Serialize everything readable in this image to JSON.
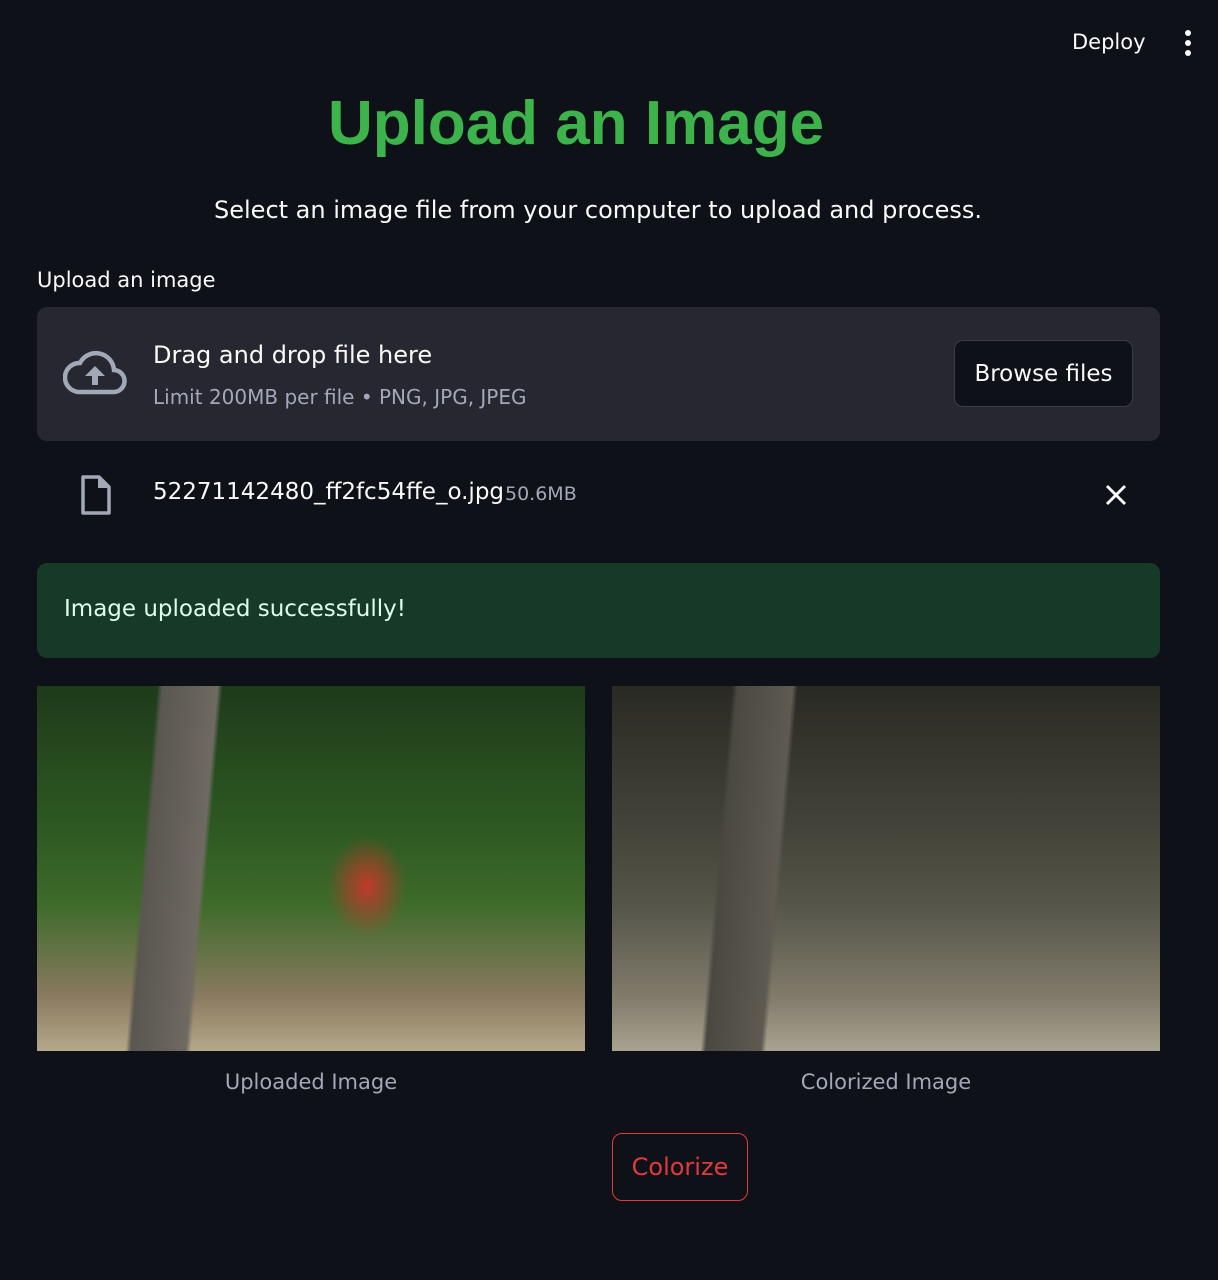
{
  "header": {
    "deploy_label": "Deploy",
    "menu_icon": "more-vertical-icon"
  },
  "title": "Upload an Image",
  "subtitle": "Select an image file from your computer to upload and process.",
  "uploader": {
    "label": "Upload an image",
    "drop_text": "Drag and drop file here",
    "limit_text": "Limit 200MB per file • PNG, JPG, JPEG",
    "browse_label": "Browse files"
  },
  "file": {
    "name": "52271142480_ff2fc54ffe_o.jpg",
    "size": "50.6MB"
  },
  "success_message": "Image uploaded successfully!",
  "images": [
    {
      "caption": "Uploaded Image"
    },
    {
      "caption": "Colorized Image"
    }
  ],
  "colorize_label": "Colorize",
  "colors": {
    "title": "#3cb44b",
    "success_bg": "#173928",
    "accent": "#e03a3e"
  }
}
